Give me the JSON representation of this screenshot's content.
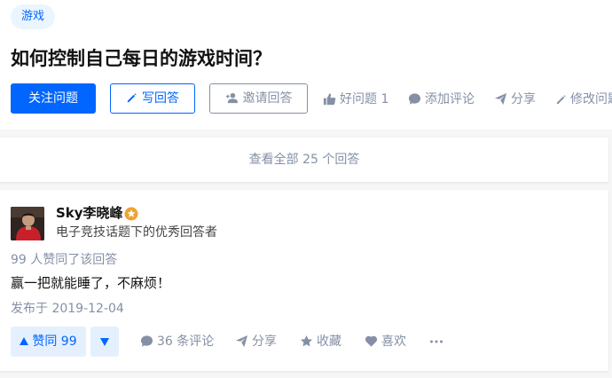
{
  "question": {
    "topic_tag": "游戏",
    "title": "如何控制自己每日的游戏时间？",
    "buttons": {
      "follow": "关注问题",
      "write": "写回答",
      "invite": "邀请回答"
    },
    "actions": {
      "good_question": "好问题 1",
      "comment": "添加评论",
      "share": "分享",
      "edit": "修改问题"
    }
  },
  "view_all": "查看全部 25 个回答",
  "answer": {
    "author_name": "Sky李晓峰",
    "author_headline": "电子竞技话题下的优秀回答者",
    "voters_text": "99 人赞同了该回答",
    "content": "赢一把就能睡了，不麻烦！",
    "published": "发布于 2019-12-04",
    "vote_up": "赞同 99",
    "actions": {
      "comments": "36 条评论",
      "share": "分享",
      "collect": "收藏",
      "like": "喜欢"
    }
  },
  "colors": {
    "brand": "#0066ff",
    "muted": "#8590a6",
    "badge": "#f1a22e"
  }
}
